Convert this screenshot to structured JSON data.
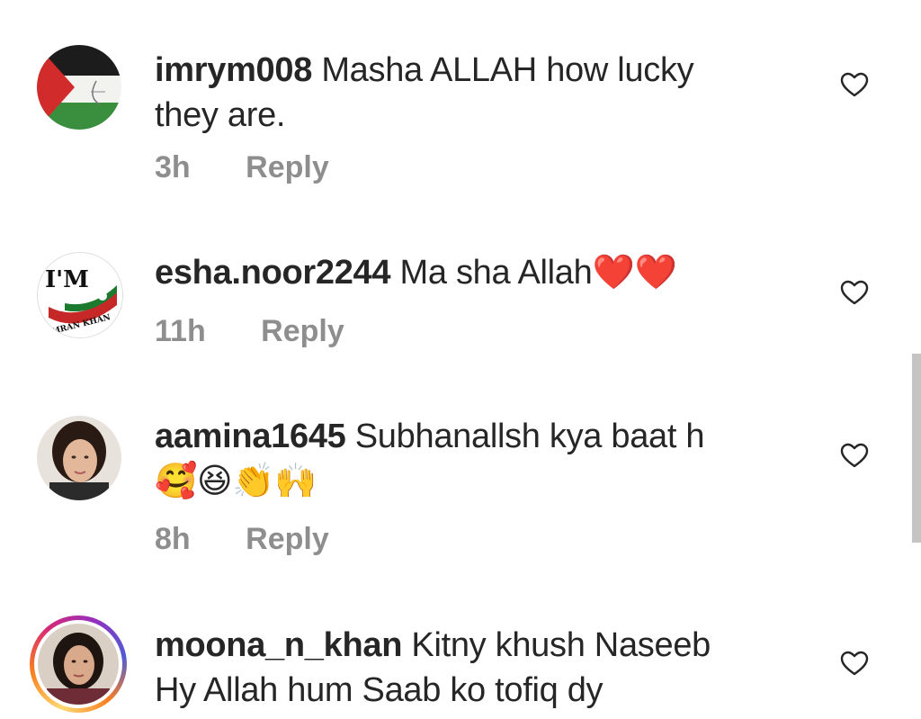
{
  "comments": [
    {
      "username": "imrym008",
      "text_line1": "Masha ALLAH how lucky",
      "text_line2": "they are.",
      "time": "3h",
      "reply": "Reply",
      "avatar_icon": "flag-avatar-icon"
    },
    {
      "username": "esha.noor2244",
      "text_line1": "Ma sha Allah",
      "emojis": "❤️❤️",
      "time": "11h",
      "reply": "Reply",
      "avatar_badge_top": "I'M",
      "avatar_badge_bottom": "IMRAN KHAN"
    },
    {
      "username": "aamina1645",
      "text_line1": "Subhanallsh kya baat h",
      "emojis": "🥰😆👏🙌",
      "time": "8h",
      "reply": "Reply",
      "avatar_icon": "profile-photo-avatar"
    },
    {
      "username": "moona_n_khan",
      "text_line1": "Kitny khush Naseeb",
      "text_line2": "Hy Allah hum Saab ko tofiq dy",
      "avatar_icon": "story-ring-avatar"
    }
  ],
  "colors": {
    "text": "#262626",
    "secondary": "#8e8e8e",
    "heart_red": "#e0262b"
  }
}
